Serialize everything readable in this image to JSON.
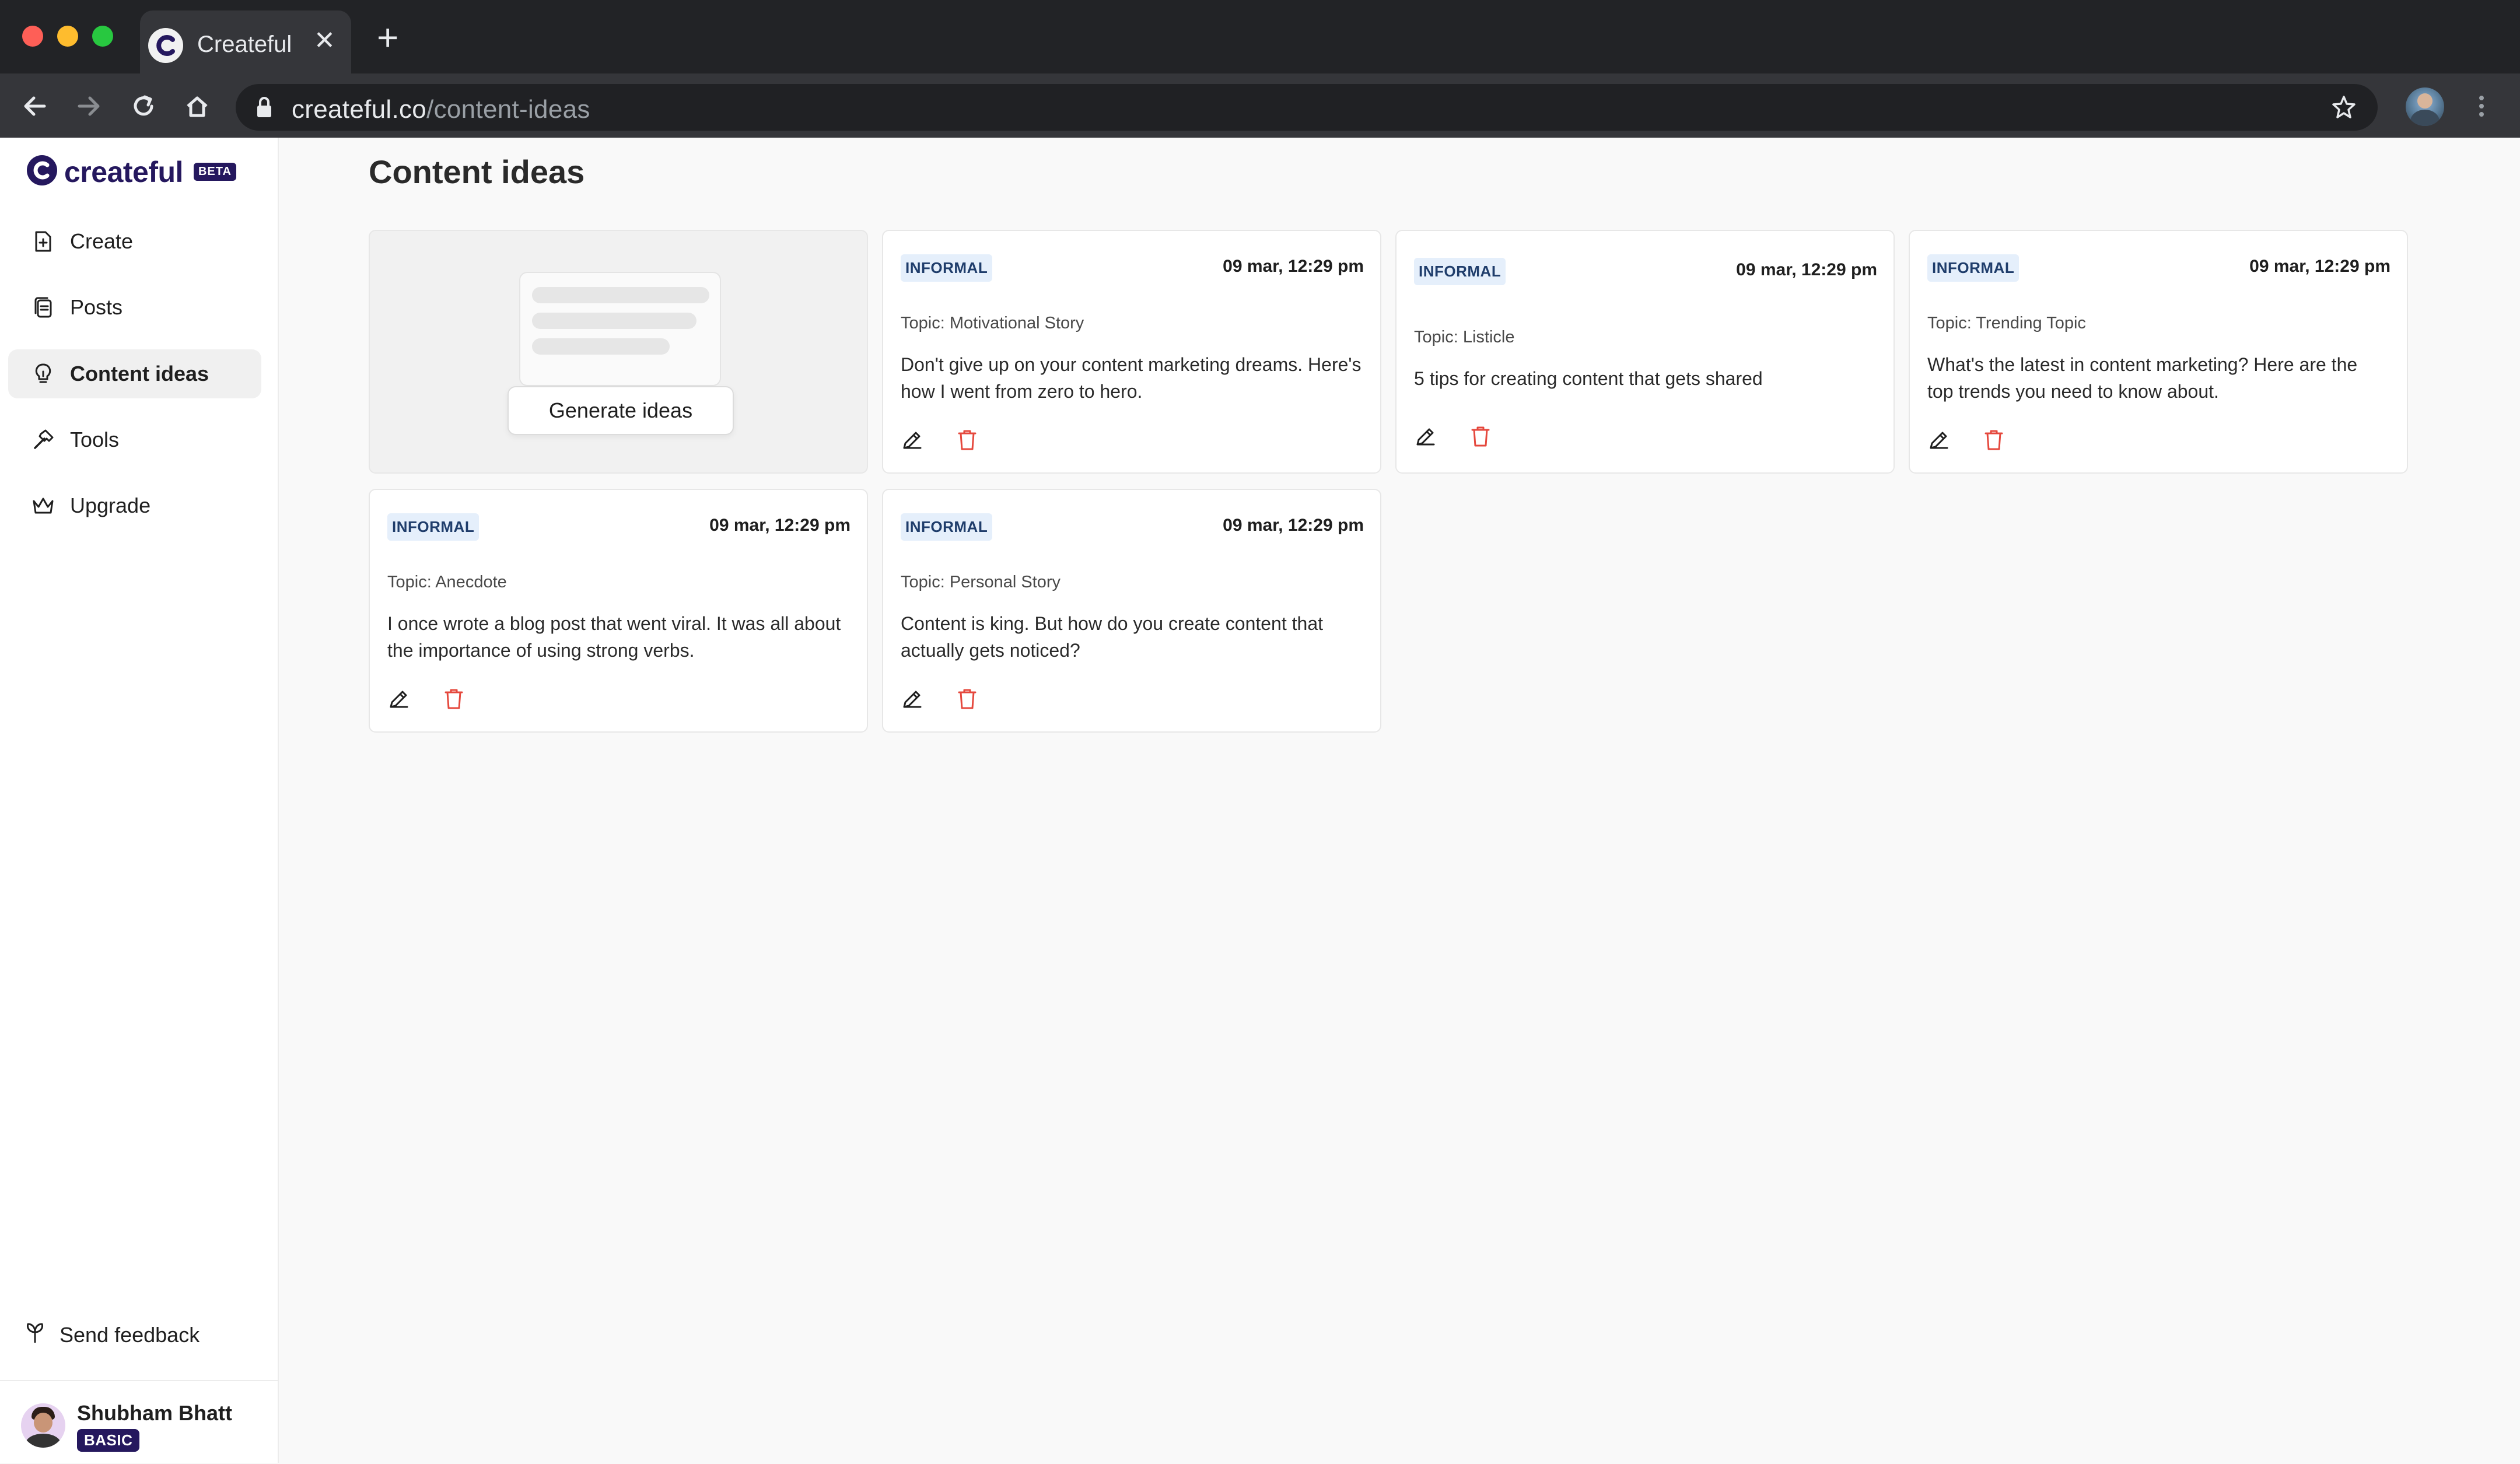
{
  "browser": {
    "tab_title": "Createful",
    "url_host": "createful.co",
    "url_path": "/content-ideas"
  },
  "sidebar": {
    "brand": "createful",
    "beta_label": "BETA",
    "items": [
      {
        "label": "Create",
        "icon": "file-plus-icon"
      },
      {
        "label": "Posts",
        "icon": "document-stack-icon"
      },
      {
        "label": "Content ideas",
        "icon": "lightbulb-icon",
        "active": true
      },
      {
        "label": "Tools",
        "icon": "hammer-icon"
      },
      {
        "label": "Upgrade",
        "icon": "crown-icon"
      }
    ],
    "feedback_label": "Send feedback",
    "user": {
      "name": "Shubham Bhatt",
      "plan": "BASIC"
    }
  },
  "main": {
    "title": "Content ideas",
    "generate_label": "Generate ideas",
    "ideas": [
      {
        "tone": "INFORMAL",
        "date": "09 mar, 12:29 pm",
        "topic": "Topic: Motivational Story",
        "text": "Don't give up on your content marketing dreams. Here's how I went from zero to hero."
      },
      {
        "tone": "INFORMAL",
        "date": "09 mar, 12:29 pm",
        "topic": "Topic: Listicle",
        "text": "5 tips for creating content that gets shared"
      },
      {
        "tone": "INFORMAL",
        "date": "09 mar, 12:29 pm",
        "topic": "Topic: Trending Topic",
        "text": "What's the latest in content marketing? Here are the top trends you need to know about."
      },
      {
        "tone": "INFORMAL",
        "date": "09 mar, 12:29 pm",
        "topic": "Topic: Anecdote",
        "text": "I once wrote a blog post that went viral. It was all about the importance of using strong verbs."
      },
      {
        "tone": "INFORMAL",
        "date": "09 mar, 12:29 pm",
        "topic": "Topic: Personal Story",
        "text": "Content is king. But how do you create content that actually gets noticed?"
      }
    ]
  },
  "colors": {
    "brand": "#25185e",
    "delete": "#e5483d",
    "tone_badge_bg": "#e5effb"
  }
}
